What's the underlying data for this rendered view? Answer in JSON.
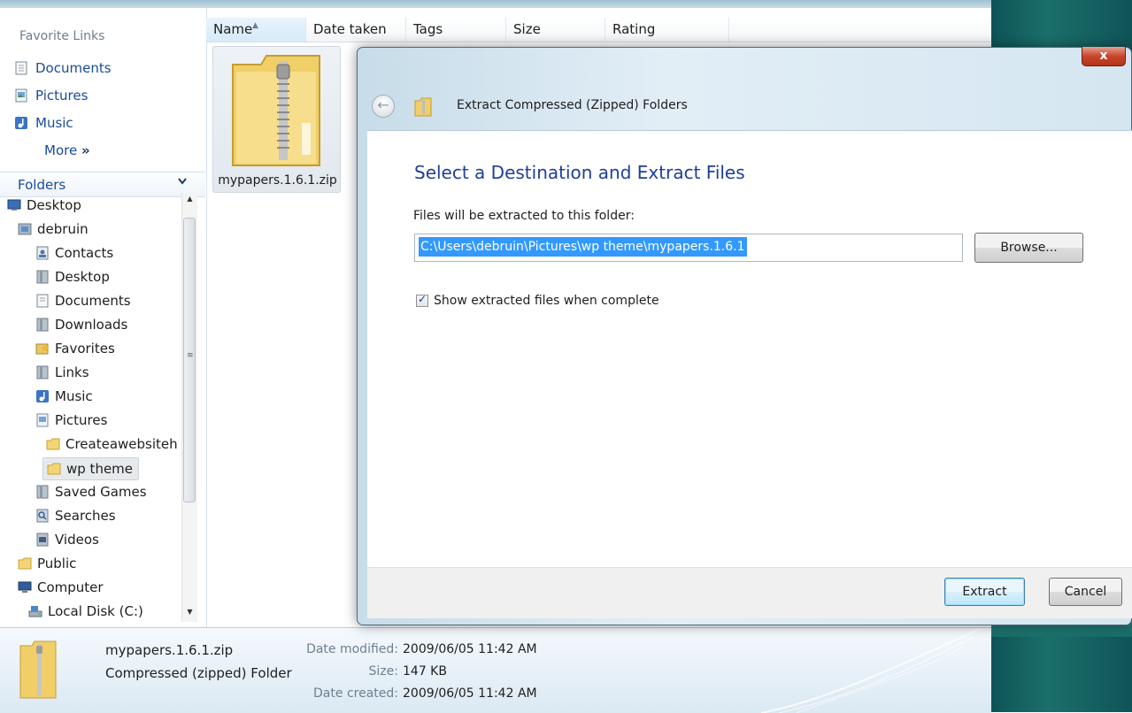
{
  "explorer": {
    "favorites": {
      "title": "Favorite Links",
      "items": [
        {
          "label": "Documents",
          "icon": "documents-icon"
        },
        {
          "label": "Pictures",
          "icon": "pictures-icon"
        },
        {
          "label": "Music",
          "icon": "music-icon"
        }
      ],
      "more_label": "More",
      "more_glyph": "»"
    },
    "folders": {
      "title": "Folders",
      "chevron": "⌄",
      "tree": [
        {
          "label": "Desktop",
          "icon": "desktop-icon"
        },
        {
          "label": "debruin",
          "icon": "user-folder-icon"
        },
        {
          "label": "Contacts",
          "icon": "contacts-icon"
        },
        {
          "label": "Desktop",
          "icon": "folder-icon"
        },
        {
          "label": "Documents",
          "icon": "documents-icon"
        },
        {
          "label": "Downloads",
          "icon": "folder-icon"
        },
        {
          "label": "Favorites",
          "icon": "favorites-icon"
        },
        {
          "label": "Links",
          "icon": "folder-icon"
        },
        {
          "label": "Music",
          "icon": "music-icon"
        },
        {
          "label": "Pictures",
          "icon": "pictures-icon"
        },
        {
          "label": "Createawebsiteh",
          "icon": "folder-icon"
        },
        {
          "label": "wp theme",
          "icon": "folder-icon",
          "selected": true
        },
        {
          "label": "Saved Games",
          "icon": "folder-icon"
        },
        {
          "label": "Searches",
          "icon": "search-icon"
        },
        {
          "label": "Videos",
          "icon": "videos-icon"
        },
        {
          "label": "Public",
          "icon": "folder-icon"
        },
        {
          "label": "Computer",
          "icon": "computer-icon"
        },
        {
          "label": "Local Disk (C:)",
          "icon": "disk-icon"
        }
      ]
    },
    "columns": [
      "Name",
      "Date taken",
      "Tags",
      "Size",
      "Rating"
    ],
    "files": [
      {
        "name": "mypapers.1.6.1.zip",
        "icon": "zip-folder-icon"
      }
    ],
    "details": {
      "name": "mypapers.1.6.1.zip",
      "type": "Compressed (zipped) Folder",
      "fields": [
        {
          "label": "Date modified:",
          "value": "2009/06/05 11:42 AM"
        },
        {
          "label": "Size:",
          "value": "147 KB"
        },
        {
          "label": "Date created:",
          "value": "2009/06/05 11:42 AM"
        }
      ]
    }
  },
  "dialog": {
    "title": "Extract Compressed (Zipped) Folders",
    "close_glyph": "x",
    "heading": "Select a Destination and Extract Files",
    "destination_label": "Files will be extracted to this folder:",
    "destination_path": "C:\\Users\\debruin\\Pictures\\wp theme\\mypapers.1.6.1",
    "browse_label": "Browse...",
    "show_files_label": "Show extracted files when complete",
    "show_files_checked": true,
    "extract_label": "Extract",
    "cancel_label": "Cancel"
  },
  "colors": {
    "link_blue": "#1a4b9c",
    "heading_blue": "#1e3f99",
    "selection_blue": "#3399ff",
    "close_red": "#c9462c",
    "aero_teal": "#1b6f6b"
  }
}
